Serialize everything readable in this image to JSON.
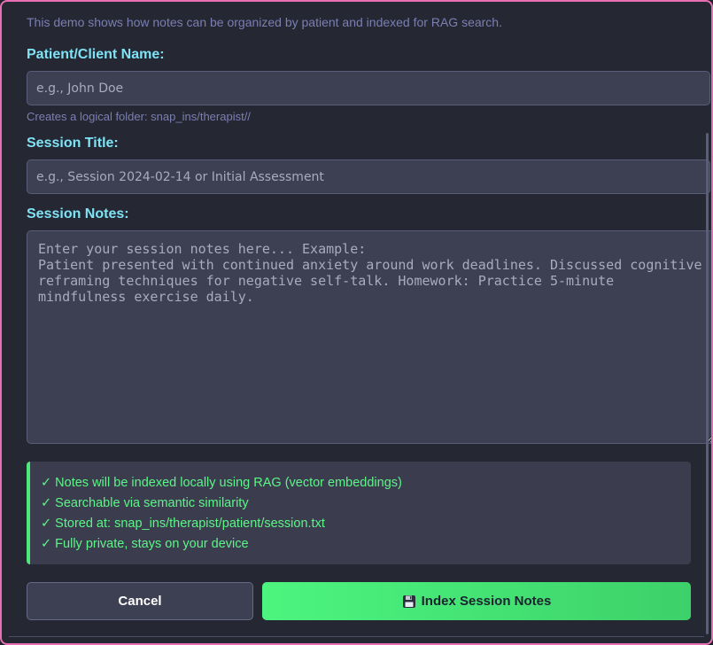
{
  "intro": {
    "description": "This demo shows how notes can be organized by patient and indexed for RAG search."
  },
  "patient": {
    "label": "Patient/Client Name:",
    "placeholder": "e.g., John Doe",
    "value": "",
    "hint": "Creates a logical folder: snap_ins/therapist//"
  },
  "session_title": {
    "label": "Session Title:",
    "placeholder": "e.g., Session 2024-02-14 or Initial Assessment",
    "value": ""
  },
  "session_notes": {
    "label": "Session Notes:",
    "placeholder": "Enter your session notes here... Example:\nPatient presented with continued anxiety around work deadlines. Discussed cognitive reframing techniques for negative self-talk. Homework: Practice 5-minute mindfulness exercise daily.",
    "value": ""
  },
  "info": {
    "items": [
      "✓ Notes will be indexed locally using RAG (vector embeddings)",
      "✓ Searchable via semantic similarity",
      "✓ Stored at: snap_ins/therapist/patient/session.txt",
      "✓ Fully private, stays on your device"
    ],
    "accent_color": "#4de87a"
  },
  "actions": {
    "cancel_label": "Cancel",
    "index_label": "Index Session Notes",
    "index_icon": "floppy-disk-icon"
  },
  "colors": {
    "border": "#e86fb3",
    "label": "#7fe3f5",
    "primary": "#4cf57f"
  }
}
